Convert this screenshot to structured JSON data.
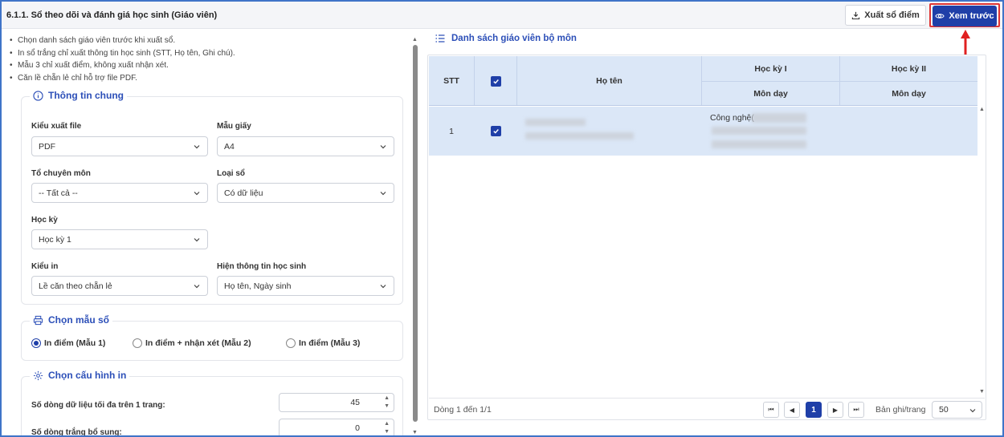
{
  "header": {
    "title": "6.1.1. Sổ theo dõi và đánh giá học sinh (Giáo viên)",
    "export_label": "Xuất sổ điểm",
    "preview_label": "Xem trước"
  },
  "notes": [
    "Chọn danh sách giáo viên trước khi xuất sổ.",
    "In sổ trắng chỉ xuất thông tin học sinh (STT, Họ tên, Ghi chú).",
    "Mẫu 3 chỉ xuất điểm, không xuất nhận xét.",
    "Căn lề chẵn lẻ chỉ hỗ trợ file PDF."
  ],
  "general": {
    "title": "Thông tin chung",
    "file_type_label": "Kiểu xuất file",
    "file_type_value": "PDF",
    "paper_label": "Mẫu giấy",
    "paper_value": "A4",
    "dept_label": "Tổ chuyên môn",
    "dept_value": "-- Tất cả --",
    "book_type_label": "Loại sổ",
    "book_type_value": "Có dữ liệu",
    "semester_label": "Học kỳ",
    "semester_value": "Học kỳ 1",
    "print_type_label": "Kiểu in",
    "print_type_value": "Lề căn theo chẵn lẻ",
    "student_info_label": "Hiện thông tin học sinh",
    "student_info_value": "Họ tên, Ngày sinh"
  },
  "template": {
    "title": "Chọn mẫu sổ",
    "options": [
      "In điểm (Mẫu 1)",
      "In điểm + nhận xét (Mẫu 2)",
      "In điểm (Mẫu 3)"
    ],
    "selected": 0
  },
  "print_config": {
    "title": "Chọn cấu hình in",
    "max_rows_label": "Số dòng dữ liệu tối đa trên 1 trang:",
    "max_rows_value": "45",
    "blank_rows_label": "Số dòng trắng bổ sung:",
    "blank_rows_value": "0"
  },
  "teacher_list": {
    "title": "Danh sách giáo viên bộ môn",
    "columns": {
      "stt": "STT",
      "name": "Họ tên",
      "sem1": "Học kỳ I",
      "sem2": "Học kỳ II",
      "subject1": "Môn dạy",
      "subject2": "Môn dạy"
    },
    "rows": [
      {
        "stt": "1",
        "subject1": "Công nghệ(",
        "checked": true
      }
    ],
    "footer_text": "Dòng 1 đến 1/1",
    "page": "1",
    "per_page_label": "Bản ghi/trang",
    "per_page_value": "50"
  },
  "colors": {
    "accent": "#1f3fa8",
    "header_bg": "#dbe7f7",
    "highlight_border": "#e03434"
  }
}
